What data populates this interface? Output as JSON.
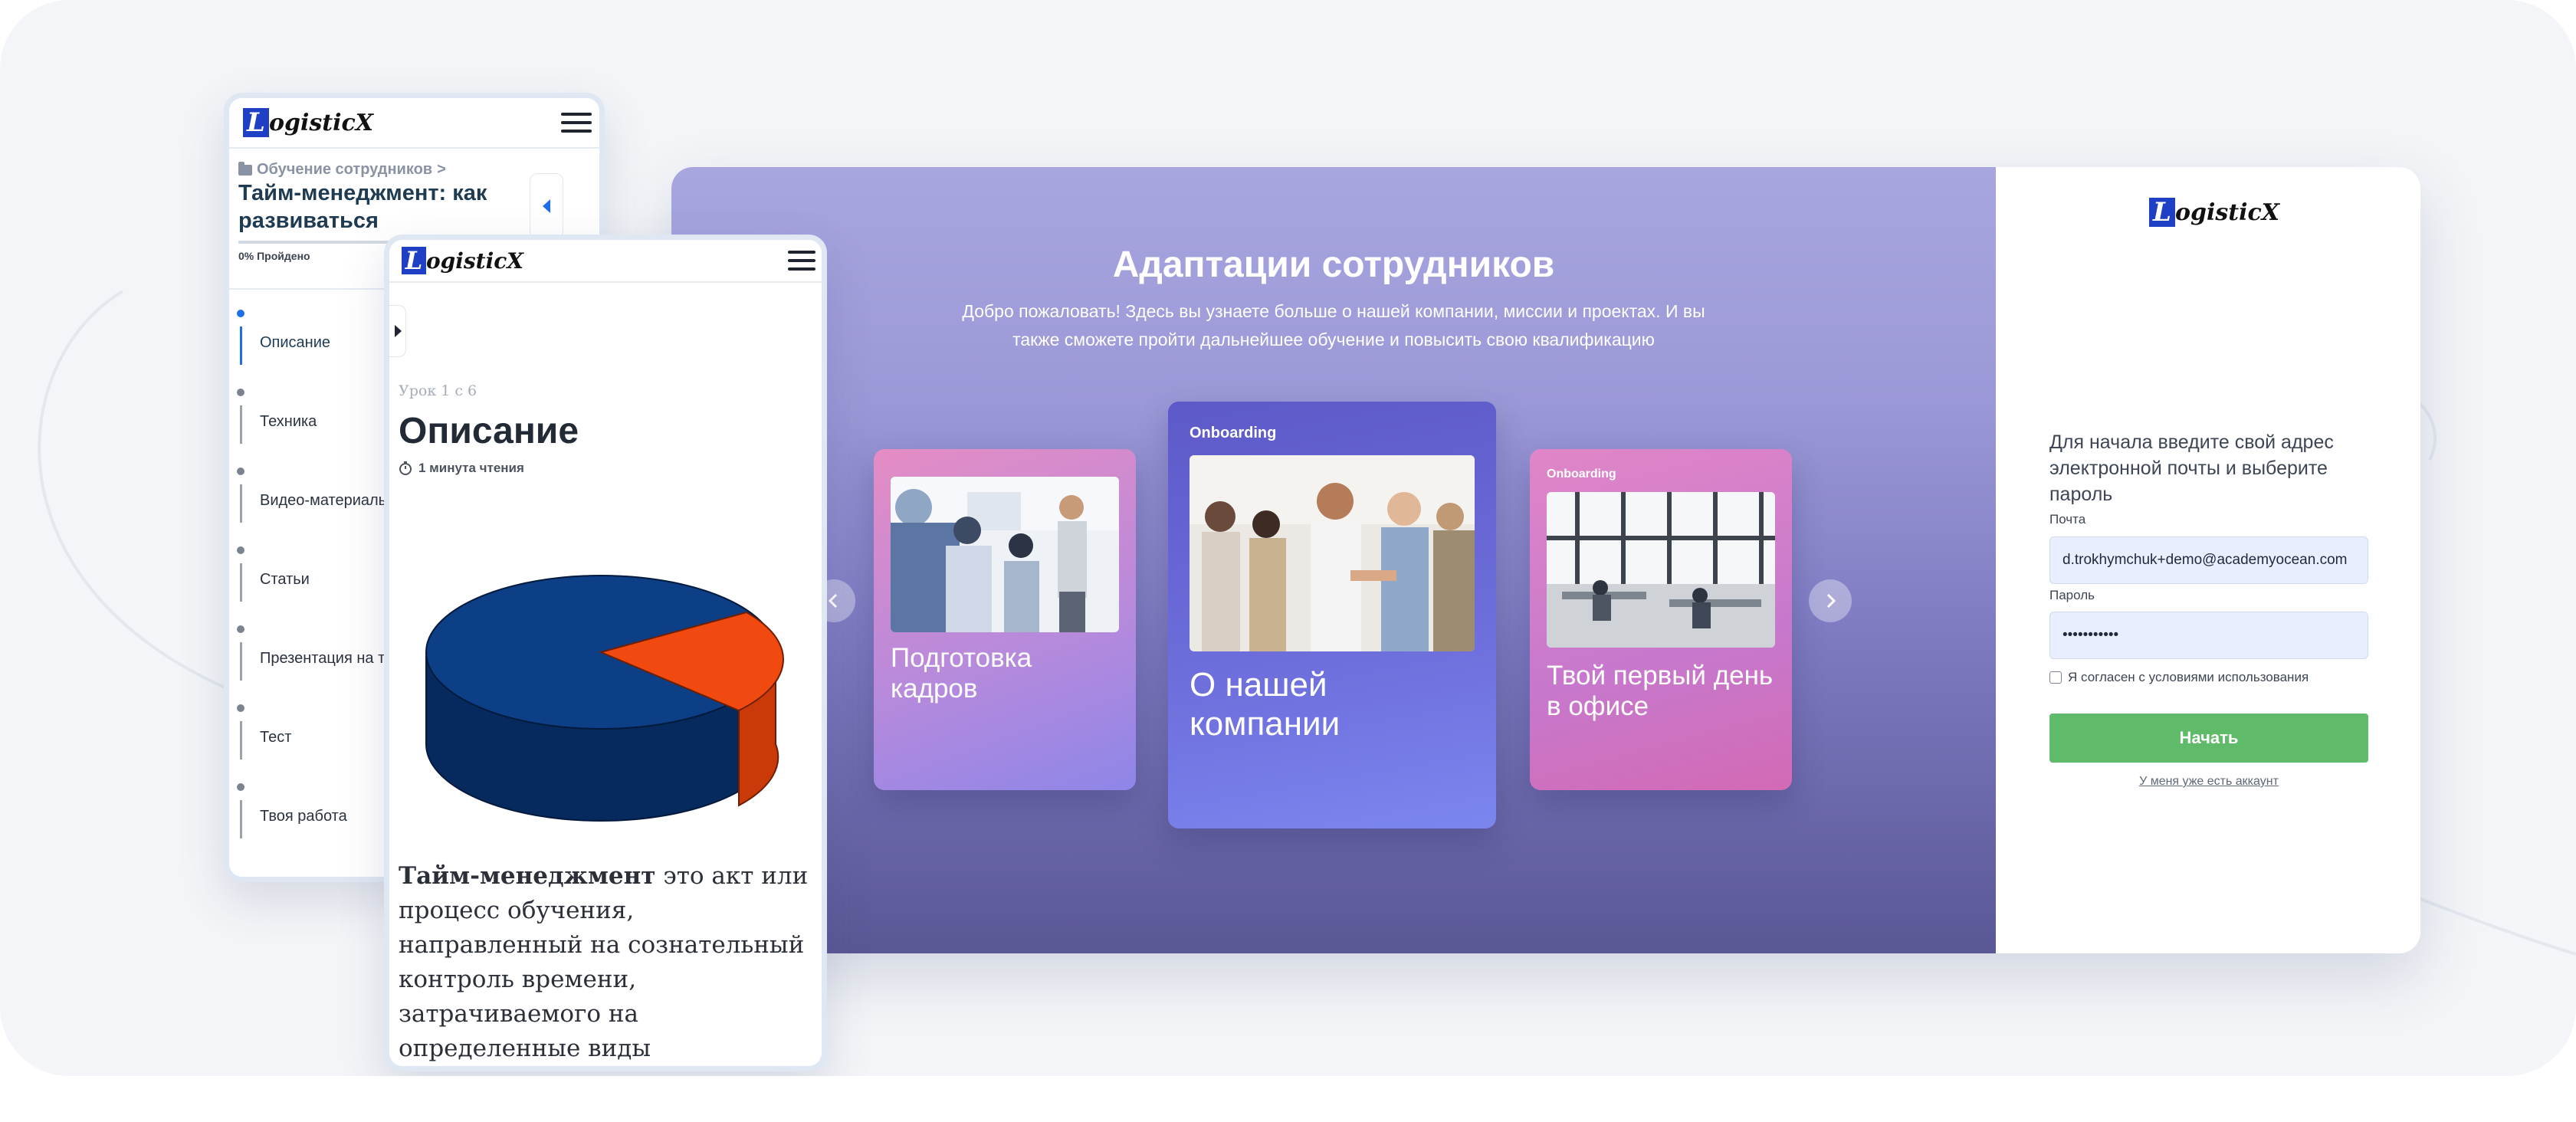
{
  "brand": {
    "logo_text": "ogisticX",
    "logo_letter": "L"
  },
  "hero": {
    "title": "Адаптации сотрудников",
    "subtitle": "Добро пожаловать! Здесь вы узнаете больше о нашей компании, миссии и проектах. И вы также сможете пройти дальнейшее обучение и повысить свою квалификацию",
    "cards": [
      {
        "tag": "",
        "title": "Подготовка кадров"
      },
      {
        "tag": "Onboarding",
        "title": "О нашей компании"
      },
      {
        "tag": "Onboarding",
        "title": "Твой первый день в офисе"
      }
    ]
  },
  "login": {
    "intro": "Для начала введите свой адрес электронной почты и выберите пароль",
    "email_label": "Почта",
    "email_value": "d.trokhymchuk+demo@academyocean.com",
    "password_label": "Пароль",
    "password_value": "•••••••••••",
    "agree_label": "Я согласен с условиями использования",
    "start_button": "Начать",
    "have_account": "У меня уже есть аккаунт"
  },
  "course_phone": {
    "breadcrumb": "Обучение сотрудников",
    "breadcrumb_sep": ">",
    "course_title": "Тайм-менеджмент: как развиваться",
    "progress_text": "0% Пройдено",
    "lessons": [
      "Описание",
      "Техника",
      "Видео-материалы",
      "Статьи",
      "Презентация на тему",
      "Тест",
      "Твоя работа"
    ]
  },
  "lesson_phone": {
    "lesson_count": "Урок 1 с 6",
    "lesson_title": "Описание",
    "read_time": "1 минута чтения",
    "body_bold": "Тайм-менеджмент",
    "body_rest": " это акт или процесс обучения, направленный на сознательный контроль времени, затрачиваемого на определенные виды деятельности, при которых эффективность и"
  },
  "colors": {
    "accent_green": "#5fba6a",
    "pie_blue": "#0d3f86",
    "pie_orange": "#f04a10",
    "logo_blue": "#1f3fc4"
  }
}
